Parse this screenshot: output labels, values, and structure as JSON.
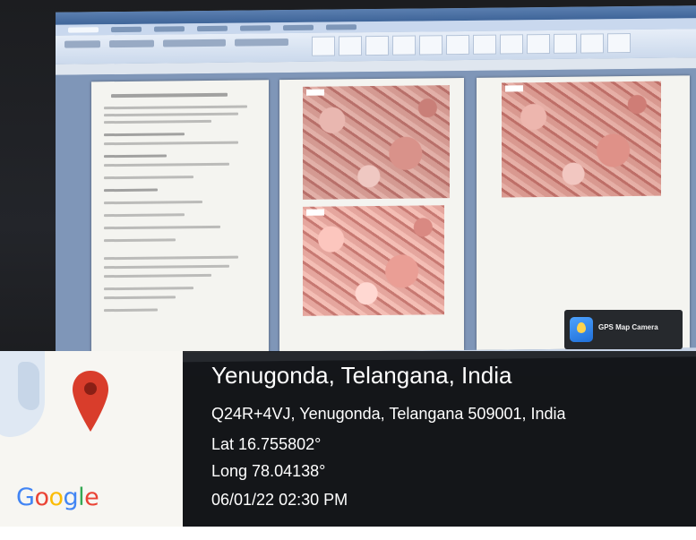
{
  "photo": {
    "subject": "laptop screen showing word processor with histology images",
    "watermark_app": {
      "label": "GPS Map Camera",
      "icon": "gps-map-camera-icon"
    }
  },
  "overlay": {
    "map": {
      "logo_text": "Google",
      "pin_icon": "map-pin-icon",
      "pin_color": "#d93d2b"
    },
    "place_title": "Yenugonda, Telangana, India",
    "address": "Q24R+4VJ, Yenugonda, Telangana 509001, India",
    "latitude": "Lat 16.755802°",
    "longitude": "Long 78.04138°",
    "datetime": "06/01/22 02:30 PM"
  },
  "colors": {
    "panel_bg": "#16181b",
    "text": "#ffffff",
    "google_blue": "#4285f4",
    "google_red": "#ea4335",
    "google_yellow": "#fbbc05",
    "google_green": "#34a853"
  }
}
